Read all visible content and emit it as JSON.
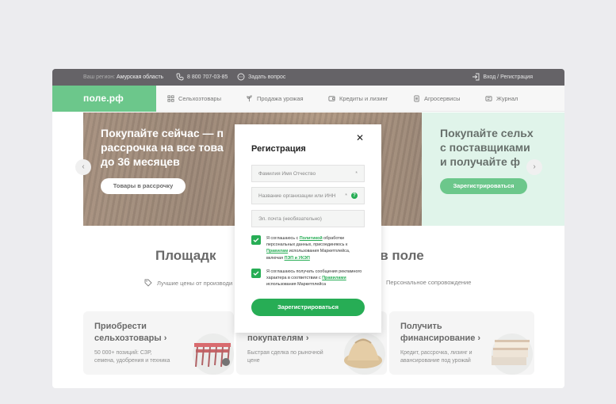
{
  "topbar": {
    "region_label": "Ваш регион:",
    "region_value": "Амурская область",
    "phone": "8 800 707-03-85",
    "ask": "Задать вопрос",
    "login": "Вход / Регистрация"
  },
  "nav": {
    "logo": "поле.рф",
    "items": [
      {
        "label": "Сельхозтовары"
      },
      {
        "label": "Продажа урожая"
      },
      {
        "label": "Кредиты и лизинг"
      },
      {
        "label": "Агросервисы"
      },
      {
        "label": "Журнал"
      }
    ]
  },
  "hero": {
    "left_line1": "Покупайте сейчас — п",
    "left_line2": "рассрочка на все това",
    "left_line3": "до 36 месяцев",
    "left_button": "Товары в рассрочку",
    "right_line1": "Покупайте сельх",
    "right_line2": "с поставщиками",
    "right_line3": "и получайте ф",
    "right_button": "Зарегистрироваться"
  },
  "content": {
    "headline_left": "Площадк",
    "headline_right": "ает в поле",
    "feature1": "Лучшие цены от производи",
    "feature2": "Персональное сопровождение",
    "cards": [
      {
        "title1": "Приобрести",
        "title2": "сельхозтовары ›",
        "desc1": "50 000+ позиций: СЗР,",
        "desc2": "семена, удобрения и техника"
      },
      {
        "title2": "покупателям ›",
        "desc1": "Быстрая сделка по рыночной",
        "desc2": "цене"
      },
      {
        "title1": "Получить",
        "title2": "финансирование ›",
        "desc1": "Кредит, рассрочка, лизинг и",
        "desc2": "авансирование под урожай"
      }
    ]
  },
  "modal": {
    "title": "Регистрация",
    "close": "✕",
    "fields": {
      "name_placeholder": "Фамилия Имя Отчество",
      "org_placeholder": "Название организации или ИНН",
      "email_placeholder": "Эл. почта (необязательно)",
      "required_mark": "*",
      "help_mark": "?"
    },
    "consent1": {
      "t1": "Я соглашаюсь с ",
      "link1": "Политикой",
      "t2": " обработки персональных данных, присоединяюсь к ",
      "link2": "Правилам",
      "t3": " использования Маркетплейса, включая ",
      "link3": "ПЭП и УКЭП"
    },
    "consent2": {
      "t1": "Я соглашаюсь получать сообщения рекламного характера в соответствии с ",
      "link1": "Правилами",
      "t2": " использования Маркетплейса"
    },
    "submit": "Зарегистрироваться"
  },
  "colors": {
    "brand_green": "#27ad55",
    "topbar": "#1c1a20",
    "hero_right_bg": "#d2efe0"
  }
}
